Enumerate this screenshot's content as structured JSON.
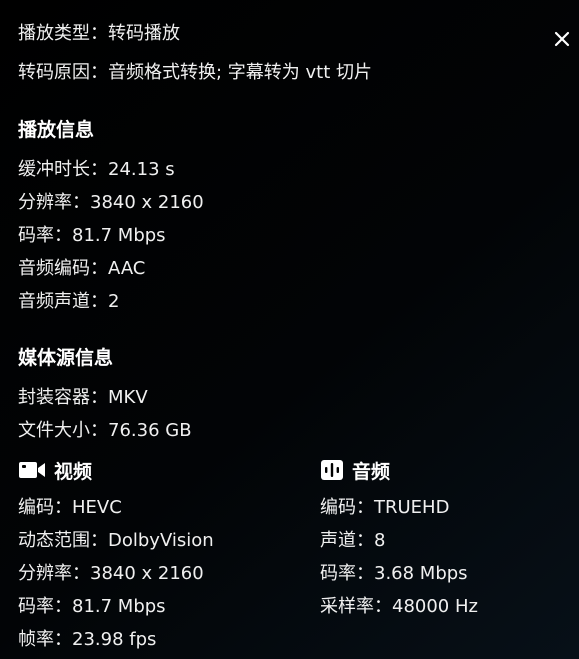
{
  "playback": {
    "type_label": "播放类型：",
    "type_value": "转码播放",
    "reason_label": "转码原因：",
    "reason_value": "音频格式转换; 字幕转为 vtt 切片"
  },
  "close_icon": "close-icon",
  "playback_info": {
    "title": "播放信息",
    "rows": [
      {
        "label": "缓冲时长：",
        "value": "24.13 s"
      },
      {
        "label": "分辨率：",
        "value": "3840 x 2160"
      },
      {
        "label": "码率：",
        "value": "81.7 Mbps"
      },
      {
        "label": "音频编码：",
        "value": "AAC"
      },
      {
        "label": "音频声道：",
        "value": "2"
      }
    ]
  },
  "source_info": {
    "title": "媒体源信息",
    "rows": [
      {
        "label": "封装容器：",
        "value": "MKV"
      },
      {
        "label": "文件大小：",
        "value": "76.36 GB"
      }
    ]
  },
  "video": {
    "title": "视频",
    "icon": "video-camera-icon",
    "rows": [
      {
        "label": "编码：",
        "value": "HEVC"
      },
      {
        "label": "动态范围：",
        "value": "DolbyVision"
      },
      {
        "label": "分辨率：",
        "value": "3840 x 2160"
      },
      {
        "label": "码率：",
        "value": "81.7 Mbps"
      },
      {
        "label": "帧率：",
        "value": "23.98 fps"
      }
    ]
  },
  "audio": {
    "title": "音频",
    "icon": "audio-waveform-icon",
    "rows": [
      {
        "label": "编码：",
        "value": "TRUEHD"
      },
      {
        "label": "声道：",
        "value": "8"
      },
      {
        "label": "码率：",
        "value": "3.68 Mbps"
      },
      {
        "label": "采样率：",
        "value": "48000 Hz"
      }
    ]
  },
  "colors": {
    "background": "#000000",
    "text": "#f0f0f0",
    "heading": "#ffffff"
  }
}
